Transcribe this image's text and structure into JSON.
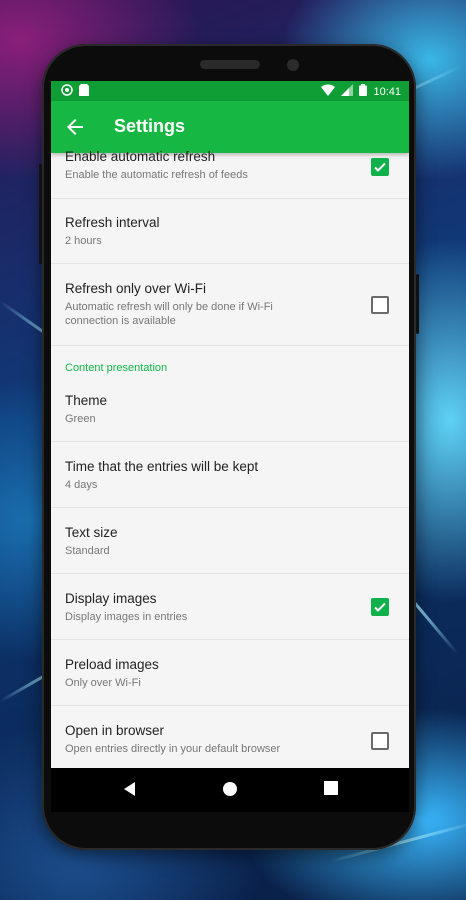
{
  "status_bar": {
    "time": "10:41",
    "icons": [
      "notification-icon",
      "sim-icon",
      "wifi-icon",
      "signal-icon",
      "battery-icon"
    ]
  },
  "app_bar": {
    "title": "Settings",
    "back_icon": "arrow-left-icon"
  },
  "settings": [
    {
      "title": "Enable automatic refresh",
      "summary": "Enable the automatic refresh of feeds",
      "checkbox": true,
      "checked": true
    },
    {
      "title": "Refresh interval",
      "summary": "2 hours",
      "checkbox": false
    },
    {
      "title": "Refresh only over Wi-Fi",
      "summary": "Automatic refresh will only be done if Wi-Fi connection is available",
      "checkbox": true,
      "checked": false
    }
  ],
  "category": {
    "label": "Content presentation"
  },
  "presentation": [
    {
      "title": "Theme",
      "summary": "Green",
      "checkbox": false
    },
    {
      "title": "Time that the entries will be kept",
      "summary": "4 days",
      "checkbox": false
    },
    {
      "title": "Text size",
      "summary": "Standard",
      "checkbox": false
    },
    {
      "title": "Display images",
      "summary": "Display images in entries",
      "checkbox": true,
      "checked": true
    },
    {
      "title": "Preload images",
      "summary": "Only over Wi-Fi",
      "checkbox": false
    },
    {
      "title": "Open in browser",
      "summary": "Open entries directly in your default browser",
      "checkbox": true,
      "checked": false
    }
  ],
  "nav_bar": {
    "icons": [
      "back-triangle-icon",
      "home-circle-icon",
      "recents-square-icon"
    ]
  },
  "colors": {
    "primary": "#17b743",
    "primary_dark": "#0f9e36",
    "accent": "#0fb24a"
  }
}
